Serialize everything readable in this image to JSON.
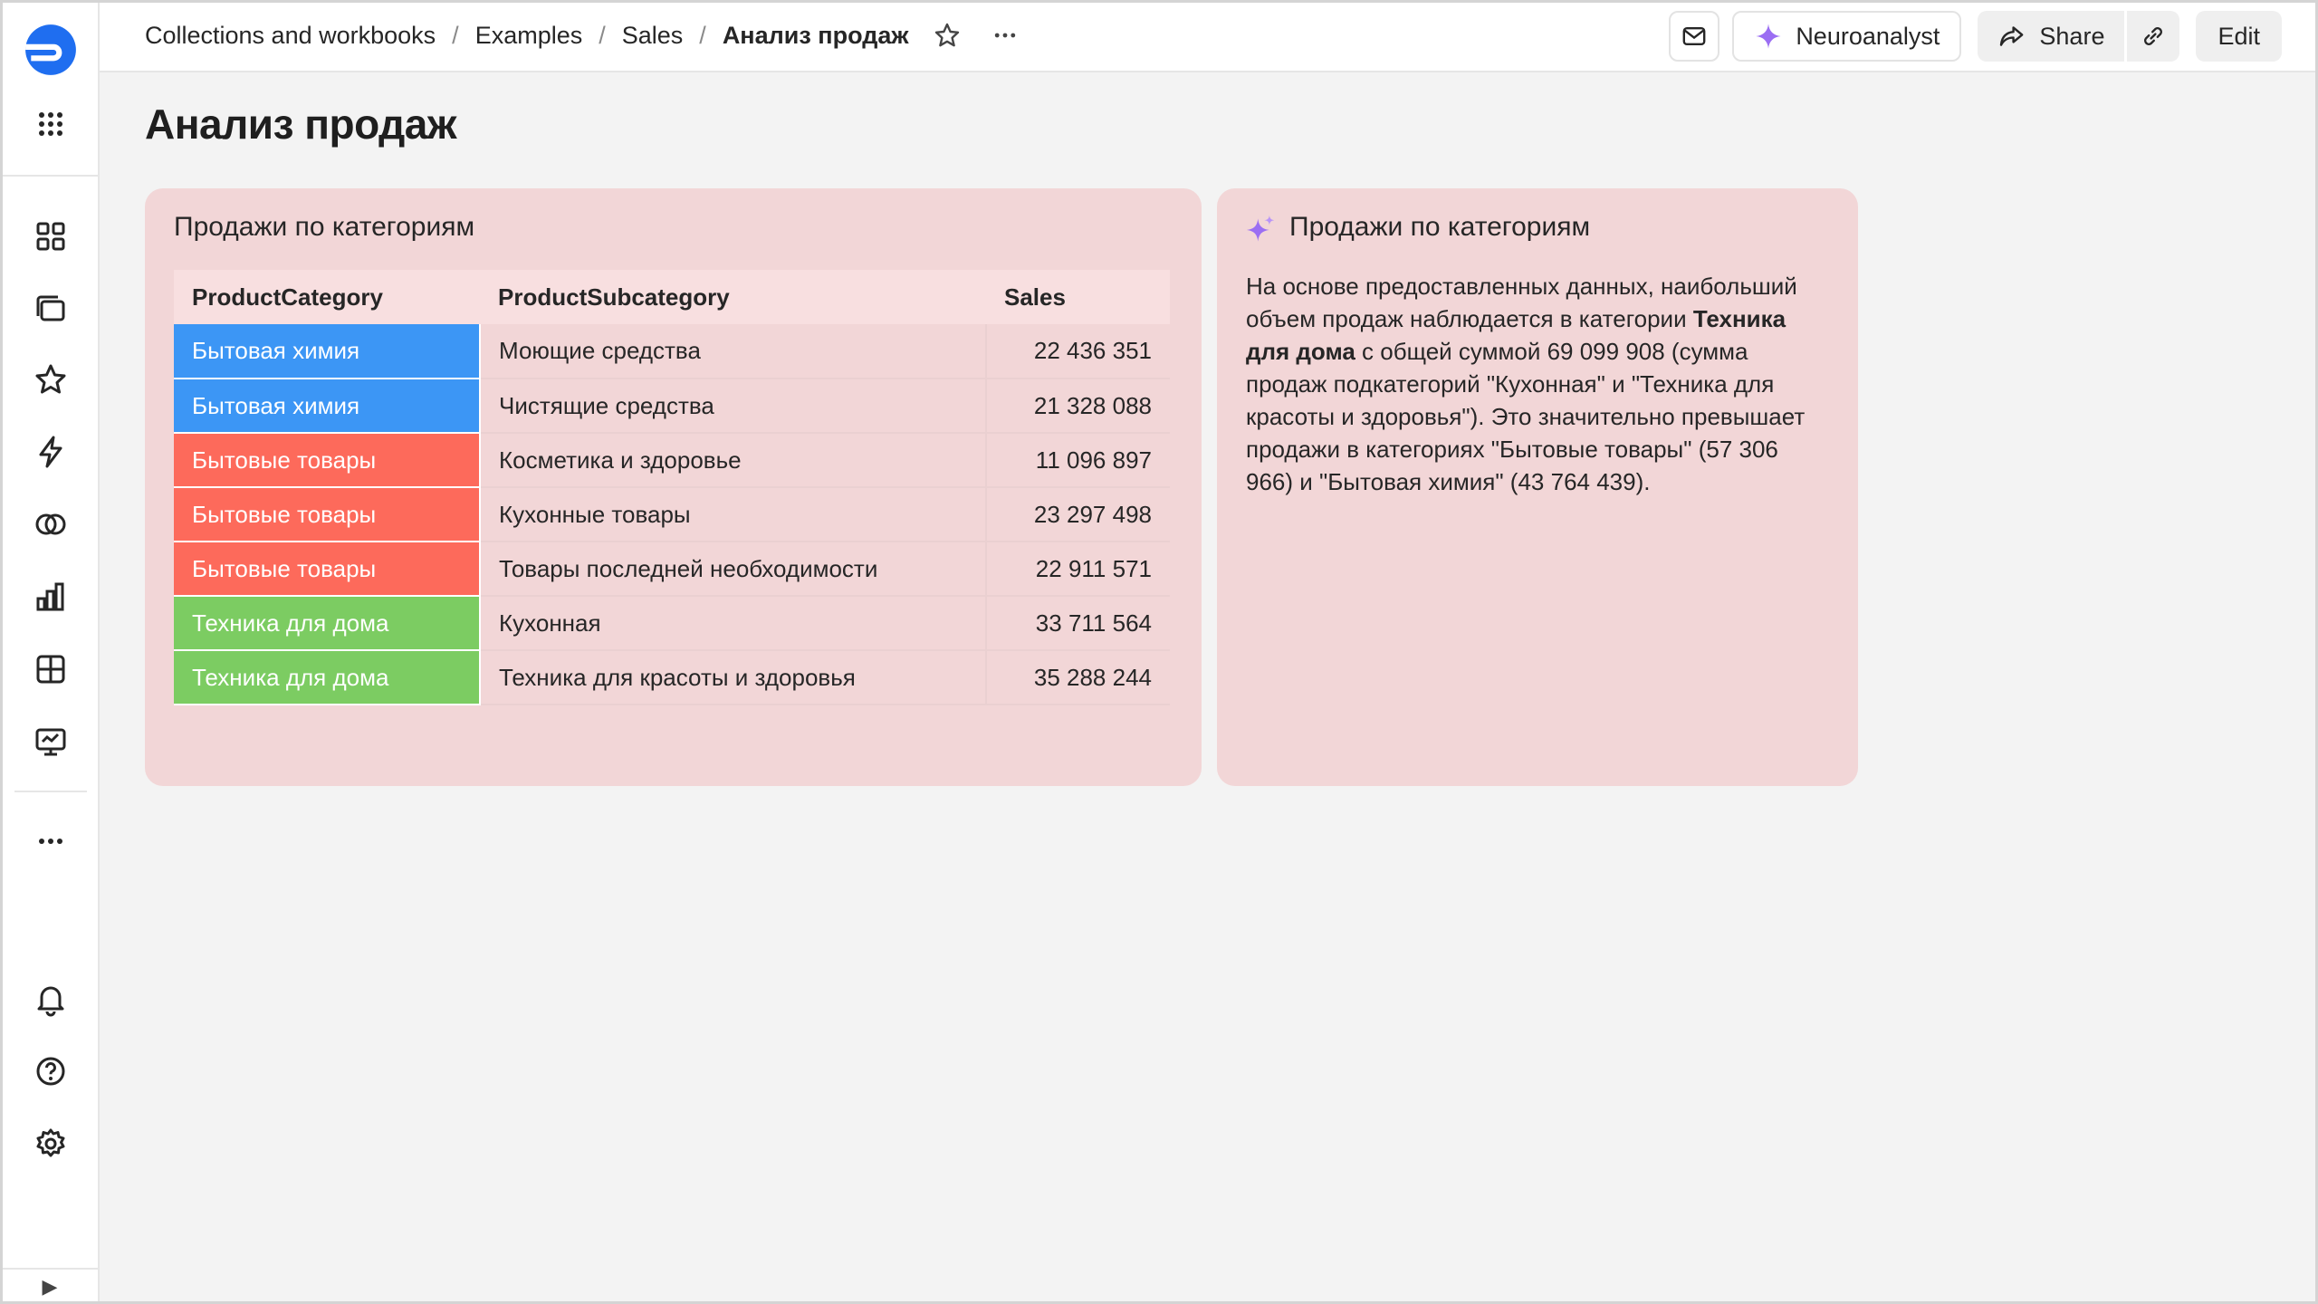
{
  "sidebar": {
    "items": [
      {
        "icon": "logo-icon"
      },
      {
        "icon": "services-grid-icon"
      },
      {
        "icon": "dashboards-icon"
      },
      {
        "icon": "collections-icon"
      },
      {
        "icon": "favorites-star-icon"
      },
      {
        "icon": "lightning-icon"
      },
      {
        "icon": "datasets-rings-icon"
      },
      {
        "icon": "charts-bars-icon"
      },
      {
        "icon": "table-grid-icon"
      },
      {
        "icon": "monitor-icon"
      },
      {
        "icon": "more-dots-icon"
      },
      {
        "icon": "bell-icon"
      },
      {
        "icon": "help-icon"
      },
      {
        "icon": "settings-gear-icon"
      }
    ],
    "collapse_glyph": "▶"
  },
  "header": {
    "breadcrumbs": [
      "Collections and workbooks",
      "Examples",
      "Sales"
    ],
    "separator": "/",
    "current": "Анализ продаж",
    "neuroanalyst_label": "Neuroanalyst",
    "share_label": "Share",
    "edit_label": "Edit"
  },
  "page": {
    "title": "Анализ продаж"
  },
  "table_widget": {
    "title": "Продажи по категориям",
    "columns": [
      "ProductCategory",
      "ProductSubcategory",
      "Sales"
    ],
    "rows": [
      {
        "category": "Бытовая химия",
        "subcategory": "Моющие средства",
        "sales": "22 436 351",
        "color": "#3c96f5"
      },
      {
        "category": "Бытовая химия",
        "subcategory": "Чистящие средства",
        "sales": "21 328 088",
        "color": "#3c96f5"
      },
      {
        "category": "Бытовые товары",
        "subcategory": "Косметика и здоровье",
        "sales": "11 096 897",
        "color": "#fd6a5b"
      },
      {
        "category": "Бытовые товары",
        "subcategory": "Кухонные товары",
        "sales": "23 297 498",
        "color": "#fd6a5b"
      },
      {
        "category": "Бытовые товары",
        "subcategory": "Товары последней необходимости",
        "sales": "22 911 571",
        "color": "#fd6a5b"
      },
      {
        "category": "Техника для дома",
        "subcategory": "Кухонная",
        "sales": "33 711 564",
        "color": "#7ccc62"
      },
      {
        "category": "Техника для дома",
        "subcategory": "Техника для красоты и здоровья",
        "sales": "35 288 244",
        "color": "#7ccc62"
      }
    ]
  },
  "ai_widget": {
    "title": "Продажи по категориям",
    "text_before": "На основе предоставленных данных, наибольший объем продаж наблюдается в категории ",
    "text_bold": "Техника для дома",
    "text_after": " с общей суммой 69 099 908 (сумма продаж подкатегорий \"Кухонная\" и \"Техника для красоты и здоровья\"). Это значительно превышает продажи в категориях \"Бытовые товары\" (57 306 966) и \"Бытовая химия\" (43 764 439)."
  },
  "colors": {
    "widget_bg": "#f2d6d7",
    "accent_blue": "#1f6ef0",
    "ai_purple": "#9b6ef3"
  }
}
